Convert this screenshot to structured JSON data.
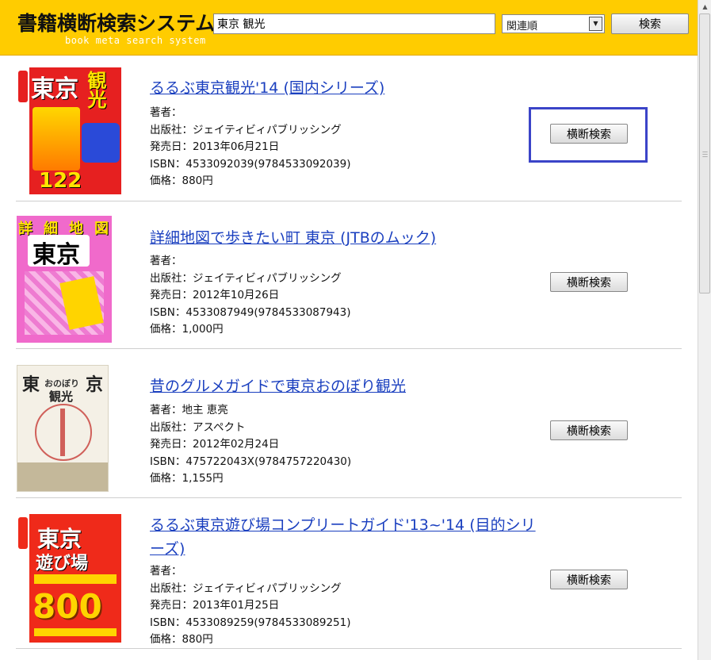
{
  "header": {
    "title": "書籍横断検索システム",
    "subtitle": "book meta search system",
    "search_value": "東京 観光",
    "sort_selected": "関連順",
    "search_button": "検索"
  },
  "labels": {
    "author": "著者：",
    "publisher": "出版社：",
    "release": "発売日：",
    "isbn": "ISBN：",
    "price": "価格："
  },
  "cross_button": "横断検索",
  "results": [
    {
      "title": "るるぶ東京観光'14 (国内シリーズ)",
      "author": "",
      "publisher": "ジェイティビィパブリッシング",
      "release": "2013年06月21日",
      "isbn": "4533092039(9784533092039)",
      "price": "880円",
      "cover_text": [
        "東京",
        "観光",
        "122"
      ]
    },
    {
      "title": "詳細地図で歩きたい町 東京 (JTBのムック)",
      "author": "",
      "publisher": "ジェイティビィパブリッシング",
      "release": "2012年10月26日",
      "isbn": "4533087949(9784533087943)",
      "price": "1,000円",
      "cover_text": [
        "詳",
        "細",
        "地",
        "図",
        "東京"
      ]
    },
    {
      "title": "昔のグルメガイドで東京おのぼり観光",
      "author": "地主 恵亮",
      "publisher": "アスペクト",
      "release": "2012年02月24日",
      "isbn": "475722043X(9784757220430)",
      "price": "1,155円",
      "cover_text": [
        "東",
        "京",
        "おのぼり",
        "観光"
      ]
    },
    {
      "title": "るるぶ東京遊び場コンプリートガイド'13~'14 (目的シリーズ)",
      "author": "",
      "publisher": "ジェイティビィパブリッシング",
      "release": "2013年01月25日",
      "isbn": "4533089259(9784533089251)",
      "price": "880円",
      "cover_text": [
        "東京",
        "遊び場",
        "800"
      ]
    }
  ],
  "colors": {
    "header_bg": "#ffcc00",
    "link": "#1a3fbf",
    "highlight": "#3b44c8"
  }
}
